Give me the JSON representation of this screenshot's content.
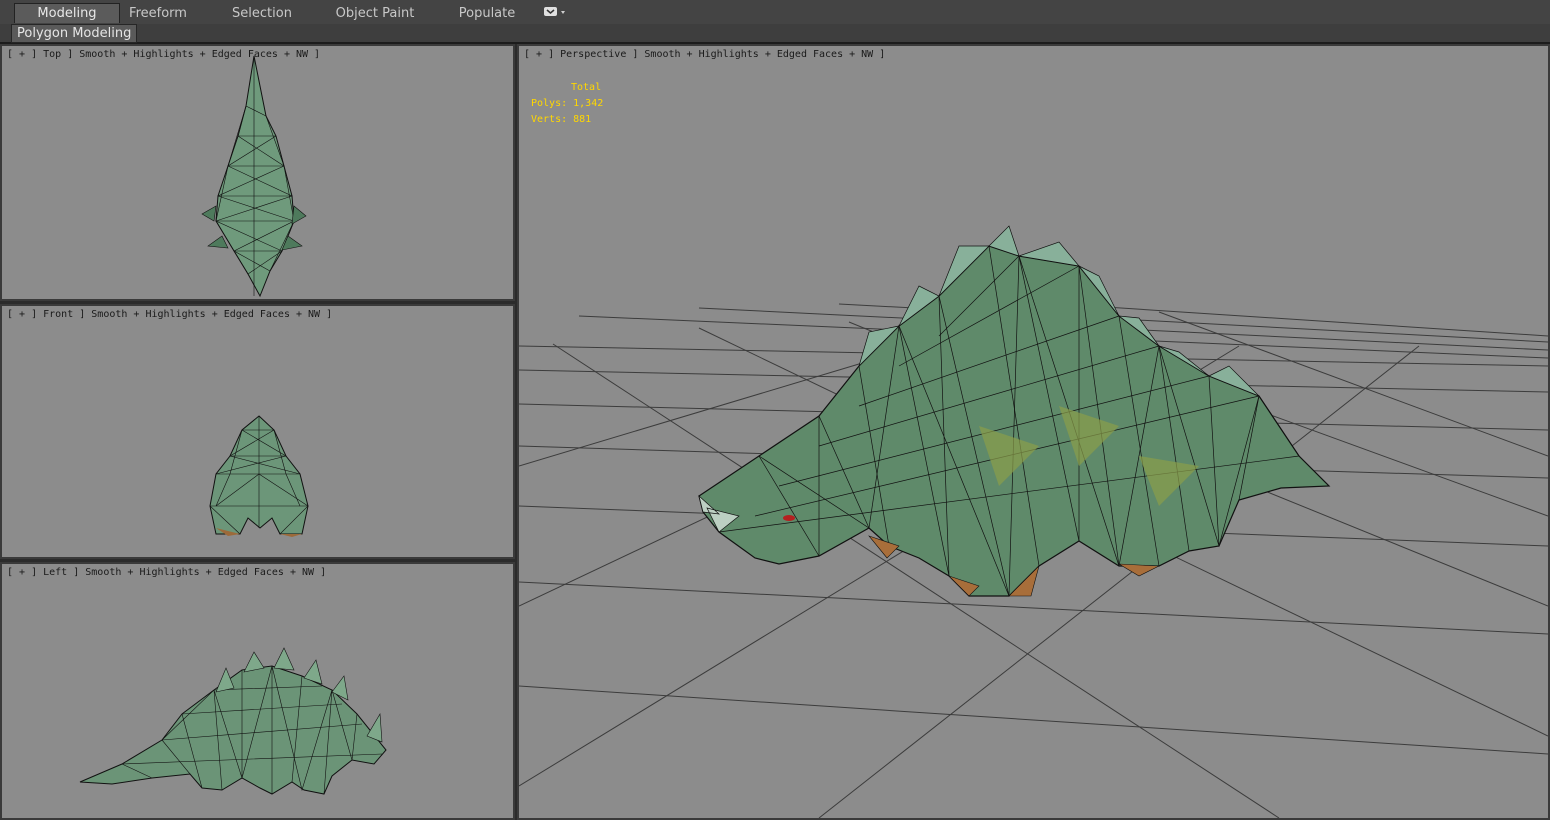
{
  "ribbon": {
    "tabs": [
      "Modeling",
      "Freeform",
      "Selection",
      "Object Paint",
      "Populate"
    ],
    "active_tab": "Modeling",
    "subtab": "Polygon Modeling",
    "menu_icon": "dropdown-icon"
  },
  "viewports": {
    "top": {
      "label": "[ + ] Top ] Smooth + Highlights + Edged Faces + NW ]"
    },
    "front": {
      "label": "[ + ] Front ] Smooth + Highlights + Edged Faces + NW ]"
    },
    "left": {
      "label": "[ + ] Left ] Smooth + Highlights + Edged Faces + NW ]"
    },
    "perspective": {
      "label": "[ + ] Perspective ] Smooth + Highlights + Edged Faces + NW ]",
      "stats": {
        "title": "Total",
        "polys": "Polys: 1,342",
        "verts": "Verts: 881"
      }
    }
  },
  "colors": {
    "stats_text": "#ffd700",
    "viewport_bg": "#8c8c8c",
    "mesh_green": "#5f8a6a"
  }
}
